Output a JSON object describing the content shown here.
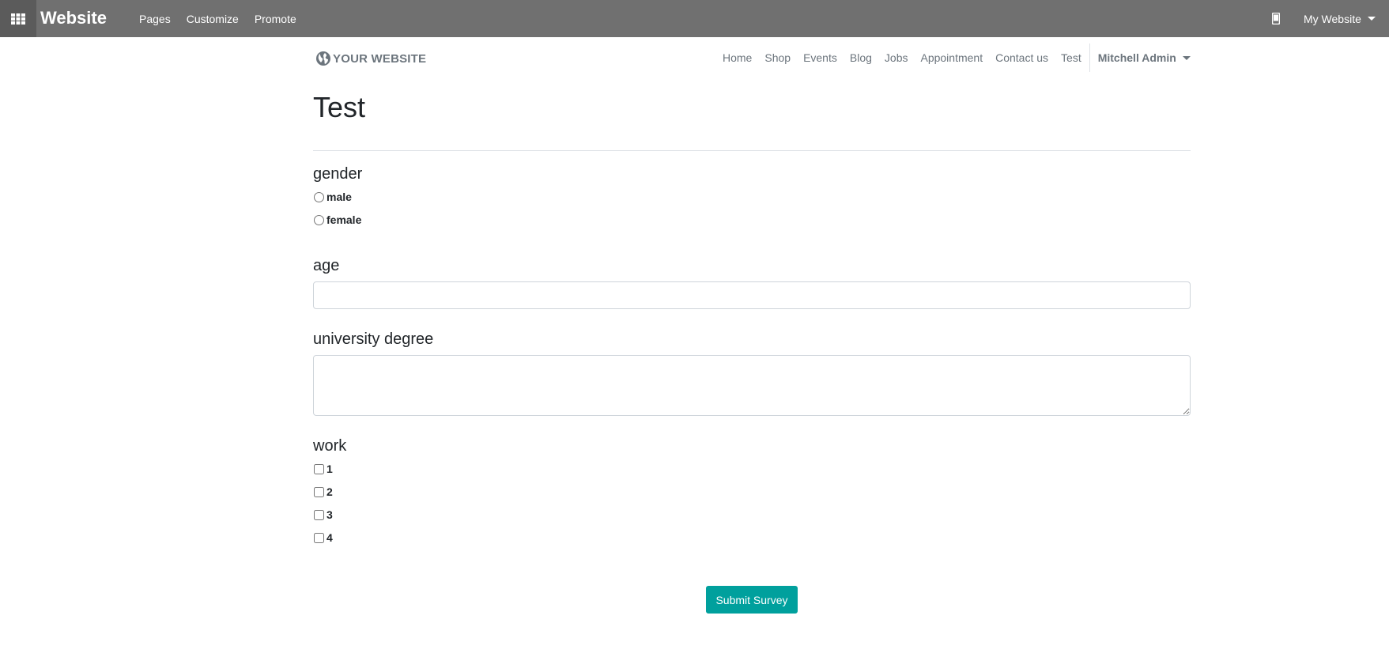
{
  "admin_bar": {
    "app_title": "Website",
    "menu": [
      "Pages",
      "Customize",
      "Promote"
    ],
    "apps_icon": "apps-grid-icon",
    "mobile_icon": "mobile-phone-icon",
    "website_switcher": "My Website"
  },
  "site_nav": {
    "logo_text": "YOUR WEBSITE",
    "logo_icon": "globe-icon",
    "links": [
      "Home",
      "Shop",
      "Events",
      "Blog",
      "Jobs",
      "Appointment",
      "Contact us",
      "Test"
    ],
    "user": "Mitchell Admin"
  },
  "survey": {
    "title": "Test",
    "questions": {
      "gender": {
        "title": "gender",
        "options": [
          "male",
          "female"
        ]
      },
      "age": {
        "title": "age",
        "value": ""
      },
      "degree": {
        "title": "university degree",
        "value": ""
      },
      "work": {
        "title": "work",
        "options": [
          "1",
          "2",
          "3",
          "4"
        ]
      }
    },
    "submit_label": "Submit Survey"
  },
  "colors": {
    "admin_bar": "#707070",
    "apps_button": "#5b5b5b",
    "primary": "#00a09d",
    "nav_text": "#6c757d"
  }
}
